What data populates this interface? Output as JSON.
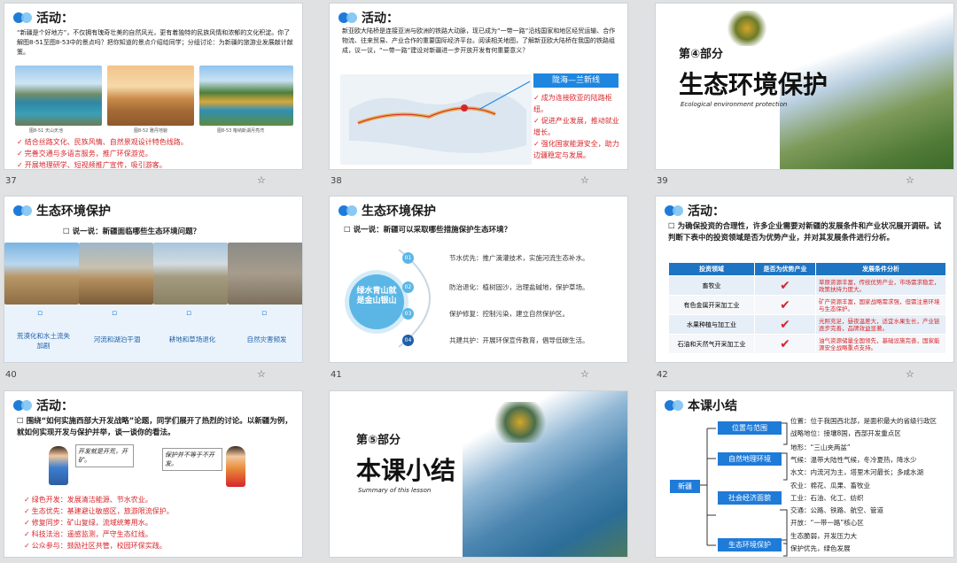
{
  "slides": {
    "s37": {
      "number": "37",
      "title": "活动：",
      "intro": "“新疆是个好地方”，不仅拥有瑰奇壮美的自然风光，更有着独特的民族风情和浓郁的文化积淀。你了解图8-51至图8-53中的景点吗？把你知道的景点介绍给同学；分组讨论：为新疆的旅游业发展献计献策。",
      "captions": [
        "图8-51 天山天池",
        "图8-52 雅丹地貌",
        "图8-53 喀纳斯湖月亮湾"
      ],
      "points": [
        "结合丝路文化、民族风情、自然景观设计特色线路。",
        "完善交通与多语言服务，推广环保游览。",
        "开展地理研学、短视频推广宣传，吸引游客。"
      ]
    },
    "s38": {
      "number": "38",
      "title": "活动：",
      "intro": "新亚欧大陆桥是连接亚洲与欧洲的铁路大动脉，现已成为“一带一路”沿线国家和地区经贸运输、合作物流、往来贸易、产业合作的重要国际经济平台。阅读相关地图，了解新亚欧大陆桥在我国的铁路组成，议一议，“一带一路”建设对新疆进一步开放开发有何重要意义？",
      "route_label": "陇海—兰新线",
      "points": [
        "成为连接欧亚的陆路枢纽。",
        "促进产业发展，推动就业增长。",
        "强化国家能源安全，助力边疆稳定与发展。"
      ]
    },
    "s39": {
      "number": "39",
      "part": "第④部分",
      "title": "生态环境保护",
      "subtitle": "Ecological environment protection"
    },
    "s40": {
      "number": "40",
      "title": "生态环境保护",
      "question": "说一说：新疆面临哪些生态环境问题？",
      "problems": [
        "荒漠化和水土流失加剧",
        "河流和湖泊干涸",
        "耕地和草场退化",
        "自然灾害频发"
      ]
    },
    "s41": {
      "number": "41",
      "title": "生态环境保护",
      "question": "说一说：新疆可以采取哪些措施保护生态环境？",
      "center": "绿水青山就是金山银山",
      "measures": [
        {
          "num": "01",
          "text": "节水优先：推广滴灌技术，实施河流生态补水。"
        },
        {
          "num": "02",
          "text": "防治退化：植树固沙，治理盐碱地，保护草场。"
        },
        {
          "num": "03",
          "text": "保护修复：控制污染，建立自然保护区。"
        },
        {
          "num": "04",
          "text": "共建共护：开展环保宣传教育，倡导低碳生活。"
        }
      ]
    },
    "s42": {
      "number": "42",
      "title": "活动：",
      "intro": "为确保投资的合理性，许多企业需要对新疆的发展条件和产业状况展开调研。试判断下表中的投资领域是否为优势产业，并对其发展条件进行分析。",
      "headers": [
        "投资领域",
        "是否为优势产业",
        "发展条件分析"
      ],
      "rows": [
        {
          "field": "畜牧业",
          "analysis": "草原资源丰富，传统优势产业，市场需求稳定，政策扶持力度大。"
        },
        {
          "field": "有色金属开采加工业",
          "analysis": "矿产资源丰富，国家战略需求强，但需注意环境与生态保护。"
        },
        {
          "field": "水果种植与加工业",
          "analysis": "光照充足，昼夜温差大，适宜水果生长，产业链逐步完善，品牌效益显著。"
        },
        {
          "field": "石油和天然气开采加工业",
          "analysis": "油气资源储量全国领先，基础设施完善，国家能源安全战略重点支持。"
        }
      ]
    },
    "s43": {
      "number": "43",
      "title": "活动：",
      "intro": "围绕“如何实施西部大开发战略”论题，同学们展开了热烈的讨论。以新疆为例，就如何实现开发与保护并举，谈一谈你的看法。",
      "bubble_left": "开发就是开荒，开矿。",
      "bubble_right": "保护并不等于不开发。",
      "points": [
        "绿色开发：发展清洁能源、节水农业。",
        "生态优先：基建避让敏感区，旅游限流保护。",
        "修复同步：矿山复绿，流域统筹用水。",
        "科技法治：遥感监测，严守生态红线。",
        "公众参与：鼓励社区共管，校园环保实践。"
      ]
    },
    "s44": {
      "number": "44",
      "part": "第⑤部分",
      "title": "本课小结",
      "subtitle": "Summary of this lesson"
    },
    "s45": {
      "number": "45",
      "title": "本课小结",
      "root": "新疆",
      "branches": [
        {
          "label": "位置与范围",
          "items": [
            "位置：位于我国西北部，是面积最大的省级行政区",
            "战略地位：接壤8国，西部开发重点区"
          ]
        },
        {
          "label": "自然地理环境",
          "items": [
            "地形：“三山夹两盆”",
            "气候：温带大陆性气候，冬冷夏热，降水少",
            "水文：内流河为主，塔里木河最长；多咸水湖"
          ]
        },
        {
          "label": "社会经济面貌",
          "items": [
            "农业：棉花、瓜果、畜牧业",
            "工业：石油、化工、纺织",
            "交通：公路、铁路、航空、管道",
            "开放：“一带一路”核心区"
          ]
        },
        {
          "label": "生态环境保护",
          "items": [
            "生态脆弱，开发压力大",
            "保护优先，绿色发展"
          ]
        }
      ]
    }
  },
  "colors": {
    "accent": "#1f7bd8",
    "highlight": "#d7262b",
    "header": "#1d74c2"
  }
}
